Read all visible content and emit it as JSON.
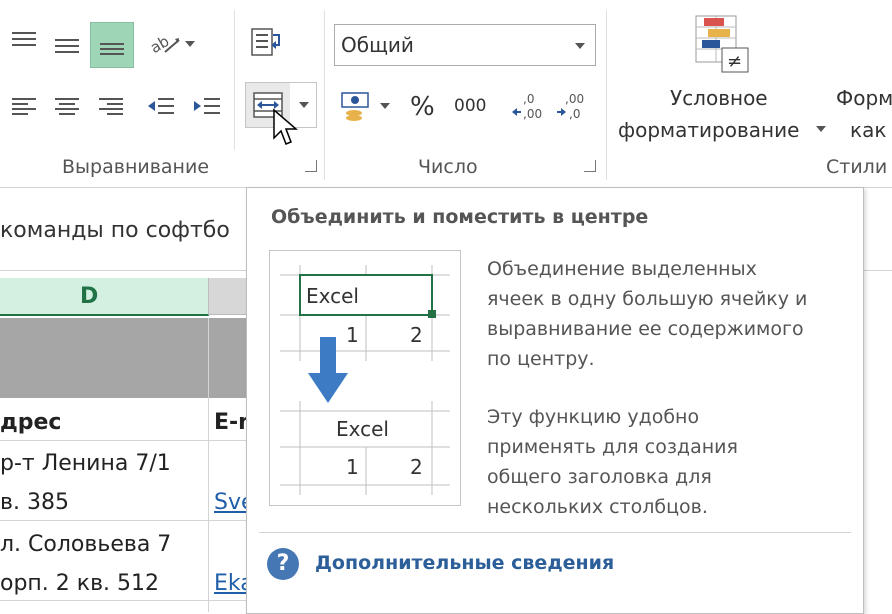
{
  "ribbon": {
    "alignment_group_label": "Выравнивание",
    "number_group_label": "Число",
    "styles_group_label": "Стили",
    "number_format_value": "Общий",
    "percent_symbol": "%",
    "thousands_symbol": "000",
    "conditional_formatting_line1": "Условное",
    "conditional_formatting_line2": "форматирование",
    "format_as_table_line1": "Форм",
    "format_as_table_line2": "как"
  },
  "sheet": {
    "formula_text": "команды по софтбо",
    "column_d_header": "D",
    "rows": [
      {
        "d": "дрес",
        "e": "E-m"
      },
      {
        "d": "р-т Ленина 7/1",
        "e": ""
      },
      {
        "d": "в. 385",
        "e": "Sve"
      },
      {
        "d": "л. Соловьева 7",
        "e": ""
      },
      {
        "d": "орп. 2 кв. 512",
        "e": "Eka"
      }
    ]
  },
  "tooltip": {
    "title": "Объединить и поместить в центре",
    "description_lines": [
      "Объединение выделенных",
      "ячеек в одну большую ячейку и",
      "выравнивание ее содержимого",
      "по центру."
    ],
    "usage_lines": [
      "Эту функцию удобно",
      "применять для создания",
      "общего заголовка для",
      "нескольких столбцов."
    ],
    "preview": {
      "before_text": "Excel",
      "before_num1": "1",
      "before_num2": "2",
      "after_text": "Excel",
      "after_num1": "1",
      "after_num2": "2"
    },
    "help_icon_glyph": "?",
    "more_info": "Дополнительные сведения"
  },
  "colors": {
    "accent_green": "#217346",
    "selected_button": "#9fd5b7",
    "link_blue": "#1f5ea8",
    "arrow_blue": "#3d7bc4"
  }
}
